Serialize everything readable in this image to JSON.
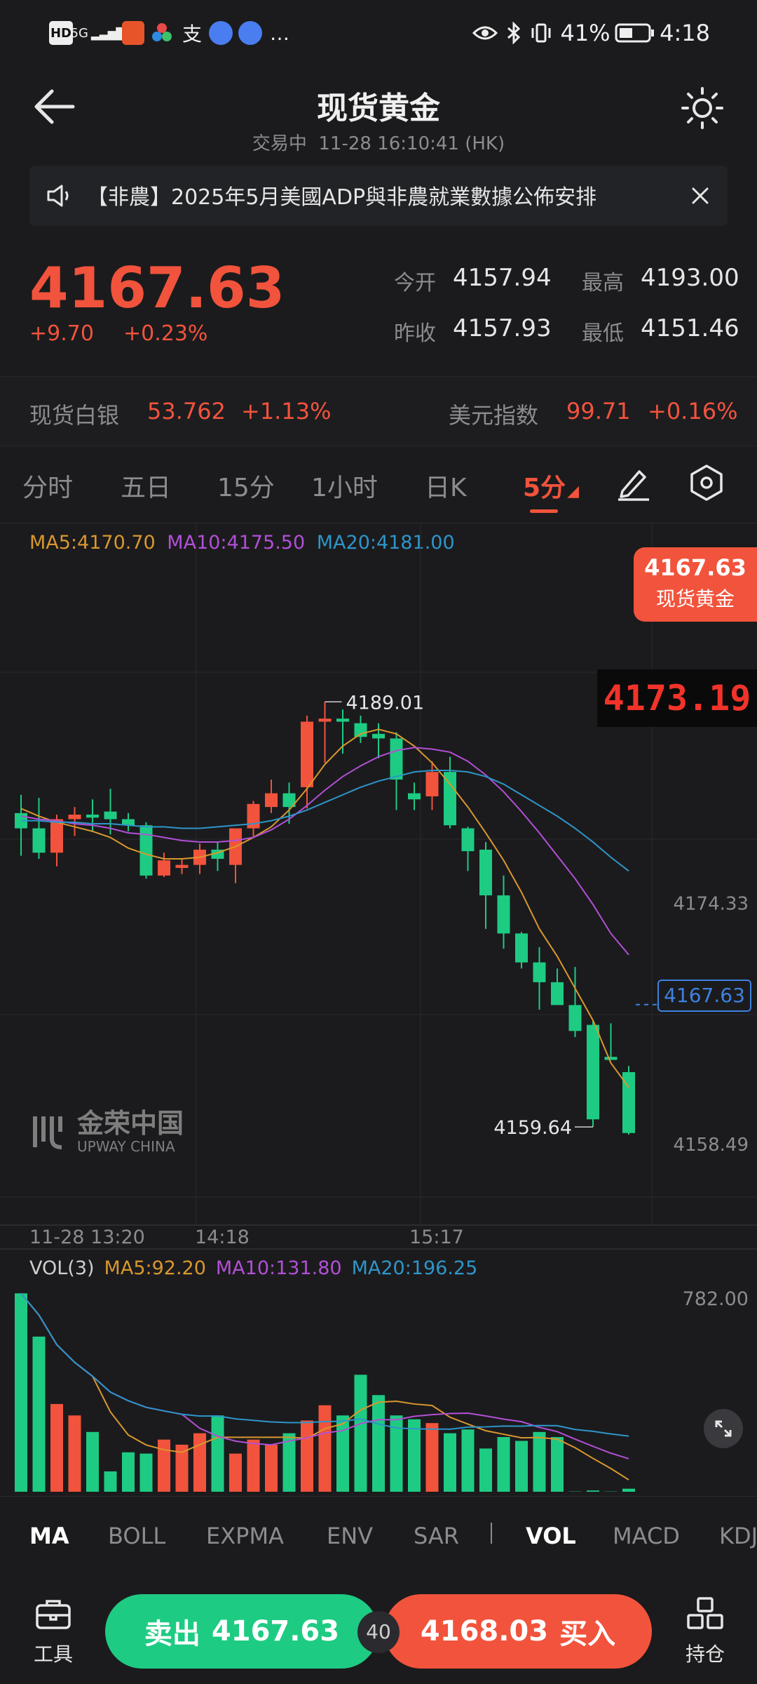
{
  "status_bar": {
    "left_icons": [
      "HD",
      "5G",
      "app-1",
      "app-2",
      "支",
      "app-4",
      "app-5",
      "…"
    ],
    "battery": "41%",
    "time": "4:18"
  },
  "nav": {
    "title": "现货黄金",
    "subtitle": "交易中  11-28 16:10:41 (HK)"
  },
  "notice": {
    "text": "【非農】2025年5月美國ADP與非農就業數據公佈安排"
  },
  "quote": {
    "price": "4167.63",
    "change": "+9.70",
    "change_pct": "+0.23%",
    "open_label": "今开",
    "open": "4157.94",
    "high_label": "最高",
    "high": "4193.00",
    "prev_label": "昨收",
    "prev": "4157.93",
    "low_label": "最低",
    "low": "4151.46"
  },
  "related": {
    "silver_label": "现货白银",
    "silver_price": "53.762",
    "silver_pct": "+1.13%",
    "usd_label": "美元指数",
    "usd_price": "99.71",
    "usd_pct": "+0.16%"
  },
  "tabs": [
    "分时",
    "五日",
    "15分",
    "1小时",
    "日K",
    "5分"
  ],
  "active_tab": "5分",
  "chart_data": {
    "type": "candlestick",
    "ma_legend": {
      "ma5": "MA5:4170.70",
      "ma10": "MA10:4175.50",
      "ma20": "MA20:4181.00"
    },
    "price_tag": {
      "price": "4167.63",
      "name": "现货黄金"
    },
    "crosshair_value": "4173.19",
    "y_labels": [
      "4174.33",
      "4167.63",
      "4158.49"
    ],
    "max_label": "4189.01",
    "min_label": "4159.64",
    "x_labels": [
      "11-28 13:20",
      "14:18",
      "15:17"
    ],
    "watermark": "金荣中国",
    "watermark_en": "UPWAY CHINA",
    "candles": [
      [
        4180.2,
        4181.4,
        4177.4,
        4179.2
      ],
      [
        4179.2,
        4181.2,
        4177.2,
        4177.6
      ],
      [
        4177.6,
        4180.1,
        4176.7,
        4179.8
      ],
      [
        4179.8,
        4180.6,
        4178.7,
        4180.1
      ],
      [
        4180.1,
        4181.1,
        4179.0,
        4179.9
      ],
      [
        4180.3,
        4181.8,
        4178.8,
        4179.8
      ],
      [
        4179.8,
        4180.2,
        4179.0,
        4179.4
      ],
      [
        4179.4,
        4179.6,
        4175.9,
        4176.1
      ],
      [
        4176.1,
        4177.6,
        4176.0,
        4177.1
      ],
      [
        4176.6,
        4177.2,
        4176.2,
        4176.8
      ],
      [
        4176.8,
        4178.2,
        4176.2,
        4177.8
      ],
      [
        4177.8,
        4178.3,
        4176.4,
        4177.2
      ],
      [
        4176.8,
        4179.2,
        4175.6,
        4179.2
      ],
      [
        4179.2,
        4181.0,
        4178.6,
        4180.8
      ],
      [
        4180.6,
        4182.4,
        4180.2,
        4181.5
      ],
      [
        4181.5,
        4182.2,
        4179.5,
        4180.6
      ],
      [
        4181.9,
        4186.6,
        4180.5,
        4186.2
      ],
      [
        4186.2,
        4187.5,
        4183.5,
        4186.4
      ],
      [
        4186.4,
        4187.0,
        4184.1,
        4186.2
      ],
      [
        4186.1,
        4186.6,
        4184.8,
        4185.2
      ],
      [
        4185.4,
        4186.1,
        4183.8,
        4185.1
      ],
      [
        4185.1,
        4185.5,
        4180.4,
        4182.4
      ],
      [
        4181.5,
        4182.2,
        4180.4,
        4181.1
      ],
      [
        4181.3,
        4183.6,
        4180.4,
        4182.9
      ],
      [
        4182.9,
        4183.9,
        4179.2,
        4179.4
      ],
      [
        4179.2,
        4179.3,
        4176.4,
        4177.7
      ],
      [
        4177.8,
        4178.3,
        4172.6,
        4174.8
      ],
      [
        4174.8,
        4176.1,
        4171.3,
        4172.3
      ],
      [
        4172.3,
        4172.4,
        4170.0,
        4170.4
      ],
      [
        4170.4,
        4171.4,
        4167.3,
        4169.1
      ],
      [
        4169.1,
        4170.0,
        4167.7,
        4167.6
      ],
      [
        4167.6,
        4170.1,
        4165.5,
        4165.9
      ],
      [
        4166.3,
        4166.6,
        4159.6,
        4160.1
      ],
      [
        4164.2,
        4166.4,
        4164.0,
        4164.0
      ],
      [
        4163.2,
        4163.6,
        4159.1,
        4159.2
      ]
    ],
    "ma5_line": [
      4180.5,
      4180.0,
      4179.6,
      4179.3,
      4179.0,
      4178.6,
      4177.9,
      4177.5,
      4177.2,
      4177.2,
      4177.3,
      4177.6,
      4178.0,
      4178.6,
      4179.3,
      4180.4,
      4181.8,
      4183.4,
      4184.6,
      4185.4,
      4185.7,
      4185.4,
      4184.6,
      4183.5,
      4182.1,
      4180.6,
      4178.9,
      4177.1,
      4175.0,
      4172.6,
      4170.8,
      4168.7,
      4166.6,
      4163.8,
      4162.2
    ],
    "ma10_line": [
      4180.0,
      4179.8,
      4179.7,
      4179.5,
      4179.4,
      4179.2,
      4178.9,
      4178.8,
      4178.6,
      4178.4,
      4178.3,
      4178.3,
      4178.4,
      4178.6,
      4179.1,
      4179.8,
      4180.7,
      4181.7,
      4182.6,
      4183.3,
      4183.9,
      4184.3,
      4184.5,
      4184.4,
      4184.2,
      4183.6,
      4182.7,
      4181.6,
      4180.3,
      4178.9,
      4177.4,
      4175.9,
      4174.2,
      4172.3,
      4170.9
    ],
    "ma20_line": [
      4179.7,
      4179.7,
      4179.6,
      4179.6,
      4179.5,
      4179.5,
      4179.4,
      4179.3,
      4179.3,
      4179.2,
      4179.2,
      4179.3,
      4179.4,
      4179.5,
      4179.7,
      4180.0,
      4180.4,
      4180.9,
      4181.4,
      4181.9,
      4182.3,
      4182.6,
      4182.9,
      4183.0,
      4183.0,
      4182.9,
      4182.6,
      4182.1,
      4181.4,
      4180.7,
      4180.0,
      4179.2,
      4178.3,
      4177.3,
      4176.4
    ],
    "volume": {
      "legend": {
        "title": "VOL(3)",
        "ma5": "MA5:92.20",
        "ma10": "MA10:131.80",
        "ma20": "MA20:196.25"
      },
      "y_label": "782.00",
      "values": [
        780,
        610,
        345,
        300,
        235,
        80,
        155,
        150,
        205,
        185,
        230,
        300,
        150,
        205,
        185,
        230,
        280,
        340,
        300,
        460,
        380,
        300,
        285,
        270,
        230,
        245,
        170,
        215,
        200,
        235,
        215,
        1,
        5,
        1,
        12
      ]
    }
  },
  "indicators_main": [
    "MA",
    "BOLL",
    "EXPMA",
    "ENV",
    "SAR"
  ],
  "indicators_sub": [
    "VOL",
    "MACD",
    "KDJ"
  ],
  "bottom": {
    "tools_label": "工具",
    "sell_label": "卖出",
    "sell_price": "4167.63",
    "spread": "40",
    "buy_price": "4168.03",
    "buy_label": "买入",
    "position_label": "持仓"
  },
  "colors": {
    "up": "#f2533c",
    "down": "#1ecb83",
    "ma5": "#d9972e",
    "ma10": "#b24fd6",
    "ma20": "#2e95c9",
    "background": "#1b1b1d"
  }
}
